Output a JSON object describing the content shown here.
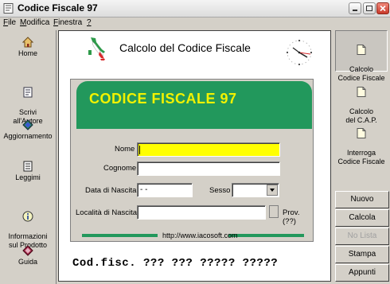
{
  "window": {
    "title": "Codice Fiscale 97"
  },
  "menu": [
    {
      "label": "File",
      "hotkey": "F"
    },
    {
      "label": "Modifica",
      "hotkey": "M"
    },
    {
      "label": "Finestra",
      "hotkey": "F"
    },
    {
      "label": "?",
      "hotkey": "?"
    }
  ],
  "left_toolbar": [
    {
      "label": "Home",
      "icon": "house-icon"
    },
    {
      "label": "Scrivi\nall'Autore",
      "icon": "letter-icon"
    },
    {
      "label": "Aggiornamento",
      "icon": "update-diamond-icon"
    },
    {
      "label": "Leggimi",
      "icon": "readme-document-icon"
    },
    {
      "label": "Informazioni\nsul Prodotto",
      "icon": "info-icon"
    },
    {
      "label": "Guida",
      "icon": "help-book-icon"
    }
  ],
  "header": {
    "title": "Calcolo del Codice Fiscale"
  },
  "form": {
    "title": "CODICE FISCALE 97",
    "nome_label": "Nome",
    "nome_value": "",
    "cognome_label": "Cognome",
    "cognome_value": "",
    "data_label": "Data di Nascita",
    "data_value": "- -",
    "sesso_label": "Sesso",
    "sesso_value": "",
    "localita_label": "Località di Nascita",
    "localita_value": "",
    "prov_label": "Prov. (??)",
    "url": "http://www.iacosoft.com"
  },
  "result": {
    "text": "Cod.fisc. ??? ??? ????? ?????"
  },
  "right_toolbar": [
    {
      "label": "Calcolo\nCodice Fiscale",
      "icon": "document-icon",
      "active": true
    },
    {
      "label": "Calcolo\ndel C.A.P.",
      "icon": "document-icon",
      "active": false
    },
    {
      "label": "Interroga\nCodice Fiscale",
      "icon": "document-icon",
      "active": false
    }
  ],
  "buttons": {
    "nuovo": "Nuovo",
    "calcola": "Calcola",
    "no_lista": "No Lista",
    "stampa": "Stampa",
    "appunti": "Appunti"
  },
  "colors": {
    "accent_green": "#22985c",
    "title_yellow": "#f2f200",
    "active_field": "#ffff00"
  }
}
